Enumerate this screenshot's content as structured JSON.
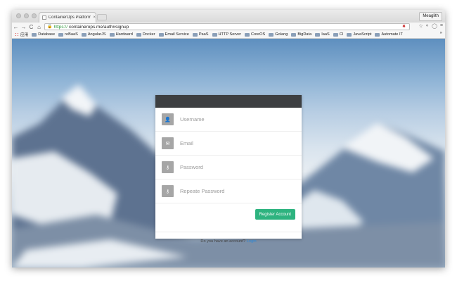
{
  "browser": {
    "tab_title": "ContainerOps Platform - A",
    "tab_close": "×",
    "profile_name": "Meaglith",
    "url_https": "https://",
    "url_rest": "containerops.me/auth#signup",
    "nav_back": "←",
    "nav_forward": "→",
    "nav_reload": "C",
    "nav_home": "⌂",
    "bookmarks": [
      {
        "label": "应用",
        "icon": "apps-icon"
      },
      {
        "label": "Database",
        "icon": "folder-icon"
      },
      {
        "label": "reBaaS",
        "icon": "folder-icon"
      },
      {
        "label": "AngularJS",
        "icon": "folder-icon"
      },
      {
        "label": "Hardward",
        "icon": "folder-icon"
      },
      {
        "label": "Docker",
        "icon": "folder-icon"
      },
      {
        "label": "Email Service",
        "icon": "folder-icon"
      },
      {
        "label": "PaaS",
        "icon": "folder-icon"
      },
      {
        "label": "HTTP Server",
        "icon": "folder-icon"
      },
      {
        "label": "CoreOS",
        "icon": "folder-icon"
      },
      {
        "label": "Golang",
        "icon": "folder-icon"
      },
      {
        "label": "BigData",
        "icon": "folder-icon"
      },
      {
        "label": "IaaS",
        "icon": "folder-icon"
      },
      {
        "label": "CI",
        "icon": "folder-icon"
      },
      {
        "label": "JavaScript",
        "icon": "folder-icon"
      },
      {
        "label": "Automate IT",
        "icon": "folder-icon"
      }
    ],
    "bookmarks_more": "»"
  },
  "signup": {
    "username_placeholder": "Username",
    "email_placeholder": "Email",
    "password_placeholder": "Password",
    "repeat_password_placeholder": "Repeate Password",
    "register_label": "Register Account",
    "footer_text": "Do you have an account?",
    "login_link": "Login"
  },
  "colors": {
    "header": "#3d3f41",
    "button": "#2db37f",
    "link": "#2d8ad9",
    "icon_box": "#a6a6a6"
  }
}
